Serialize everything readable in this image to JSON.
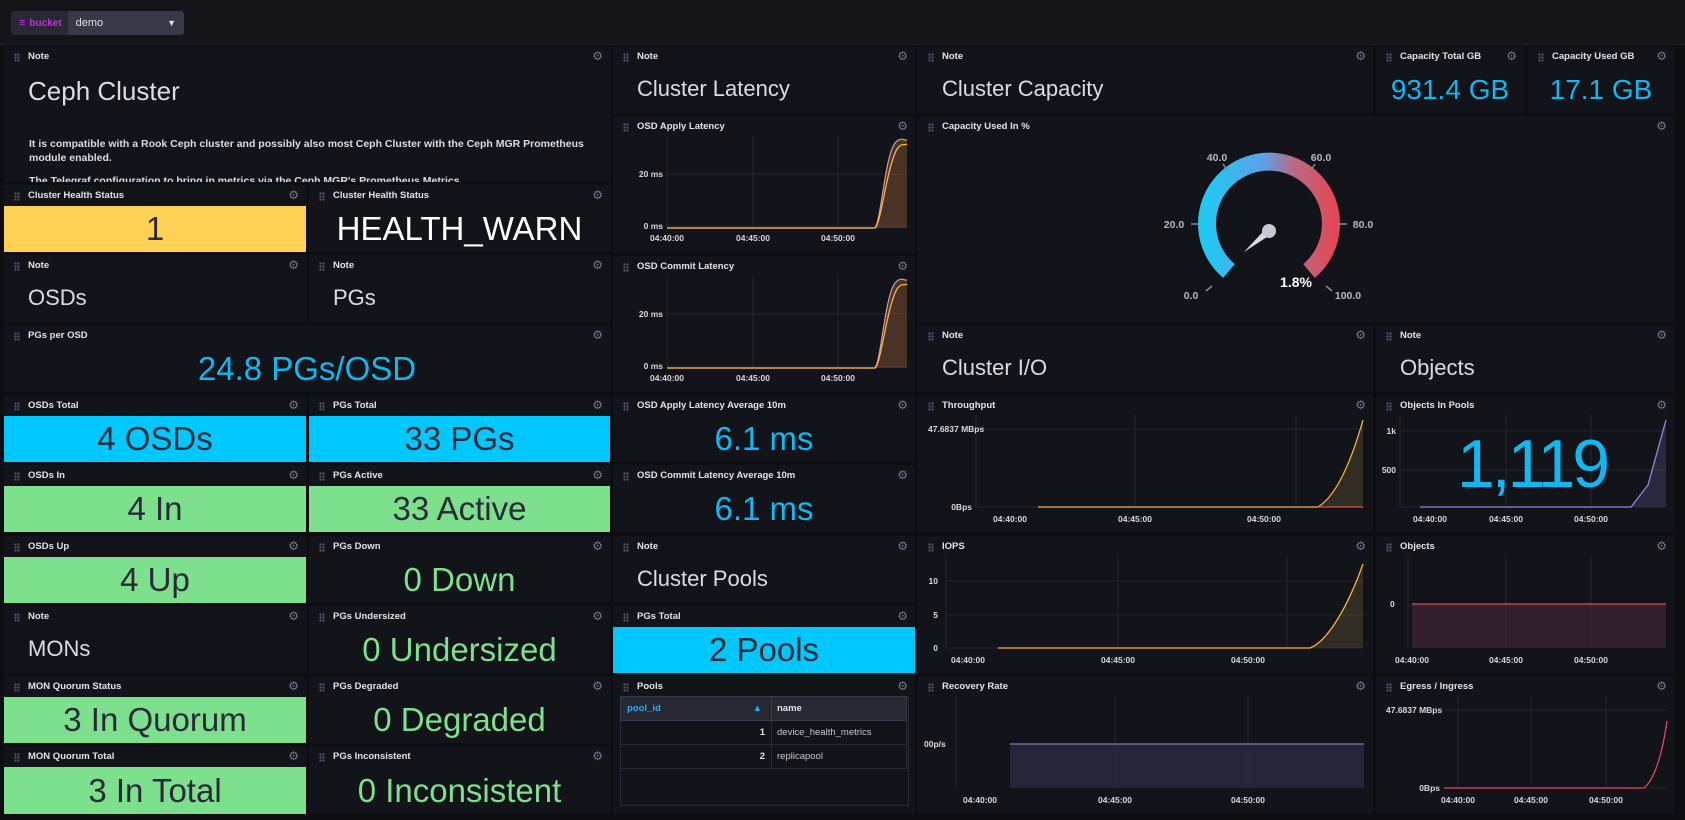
{
  "topbar": {
    "variable_label": "bucket",
    "variable_value": "demo"
  },
  "note_cluster": {
    "title": "Note",
    "heading": "Ceph Cluster",
    "para1": "It is compatible with a Rook Ceph cluster and possibly also most Ceph Cluster with the Ceph MGR Prometheus module enabled.",
    "para2": "The Telegraf configuration to bring in metrics via the Ceph MGR's Prometheus Metrics"
  },
  "cluster_health_status": {
    "title": "Cluster Health Status",
    "value": "1"
  },
  "cluster_health_status_text": {
    "title": "Cluster Health Status",
    "value": "HEALTH_WARN"
  },
  "note_osds": {
    "title": "Note",
    "heading": "OSDs"
  },
  "note_pgs": {
    "title": "Note",
    "heading": "PGs"
  },
  "pgs_per_osd": {
    "title": "PGs per OSD",
    "value": "24.8 PGs/OSD"
  },
  "osds_total": {
    "title": "OSDs Total",
    "value": "4 OSDs"
  },
  "pgs_total": {
    "title": "PGs Total",
    "value": "33 PGs"
  },
  "osds_in": {
    "title": "OSDs In",
    "value": "4 In"
  },
  "pgs_active": {
    "title": "PGs Active",
    "value": "33 Active"
  },
  "osds_up": {
    "title": "OSDs Up",
    "value": "4 Up"
  },
  "pgs_down": {
    "title": "PGs Down",
    "value": "0 Down"
  },
  "note_mons": {
    "title": "Note",
    "heading": "MONs"
  },
  "pgs_undersized": {
    "title": "PGs Undersized",
    "value": "0 Undersized"
  },
  "mon_quorum_status": {
    "title": "MON Quorum Status",
    "value": "3 In Quorum"
  },
  "pgs_degraded": {
    "title": "PGs Degraded",
    "value": "0 Degraded"
  },
  "mon_quorum_total": {
    "title": "MON Quorum Total",
    "value": "3 In Total"
  },
  "pgs_inconsistent": {
    "title": "PGs Inconsistent",
    "value": "0 Inconsistent"
  },
  "note_latency": {
    "title": "Note",
    "heading": "Cluster Latency"
  },
  "osd_apply_latency": {
    "title": "OSD Apply Latency",
    "y_ticks": [
      "20 ms",
      "0 ms"
    ],
    "x_ticks": [
      "04:40:00",
      "04:45:00",
      "04:50:00"
    ]
  },
  "osd_commit_latency": {
    "title": "OSD Commit Latency",
    "y_ticks": [
      "20 ms",
      "0 ms"
    ],
    "x_ticks": [
      "04:40:00",
      "04:45:00",
      "04:50:00"
    ]
  },
  "osd_apply_latency_avg": {
    "title": "OSD Apply Latency Average 10m",
    "value": "6.1 ms"
  },
  "osd_commit_latency_avg": {
    "title": "OSD Commit Latency Average 10m",
    "value": "6.1 ms"
  },
  "note_pools": {
    "title": "Note",
    "heading": "Cluster Pools"
  },
  "pools_total": {
    "title": "PGs Total",
    "value": "2 Pools"
  },
  "pools_table": {
    "title": "Pools",
    "columns": [
      "pool_id",
      "name"
    ],
    "rows": [
      [
        "1",
        "device_health_metrics"
      ],
      [
        "2",
        "replicapool"
      ]
    ]
  },
  "note_capacity": {
    "title": "Note",
    "heading": "Cluster Capacity"
  },
  "capacity_total": {
    "title": "Capacity Total GB",
    "value": "931.4 GB"
  },
  "capacity_used": {
    "title": "Capacity Used GB",
    "value": "17.1 GB"
  },
  "capacity_used_pct": {
    "title": "Capacity Used In %",
    "value": "1.8%",
    "value_num": 1.8,
    "ticks": [
      "0.0",
      "20.0",
      "40.0",
      "60.0",
      "80.0",
      "100.0"
    ]
  },
  "note_io": {
    "title": "Note",
    "heading": "Cluster I/O"
  },
  "note_objects": {
    "title": "Note",
    "heading": "Objects"
  },
  "throughput": {
    "title": "Throughput",
    "y_ticks": [
      "47.6837 MBps",
      "0Bps"
    ],
    "x_ticks": [
      "04:40:00",
      "04:45:00",
      "04:50:00"
    ]
  },
  "objects_in_pools": {
    "title": "Objects In Pools",
    "value": "1,119",
    "y_ticks": [
      "1k",
      "500"
    ],
    "x_ticks": [
      "04:40:00",
      "04:45:00",
      "04:50:00"
    ]
  },
  "iops": {
    "title": "IOPS",
    "y_ticks": [
      "10",
      "5",
      "0"
    ],
    "x_ticks": [
      "04:40:00",
      "04:45:00",
      "04:50:00"
    ]
  },
  "objects": {
    "title": "Objects",
    "y_ticks": [
      "0"
    ],
    "x_ticks": [
      "04:40:00",
      "04:45:00",
      "04:50:00"
    ]
  },
  "recovery_rate": {
    "title": "Recovery Rate",
    "y_ticks": [
      "00p/s"
    ],
    "x_ticks": [
      "04:40:00",
      "04:45:00",
      "04:50:00"
    ]
  },
  "egress_ingress": {
    "title": "Egress / Ingress",
    "y_ticks": [
      "47.6837 MBps",
      "0Bps"
    ],
    "x_ticks": [
      "04:40:00",
      "04:45:00",
      "04:50:00"
    ]
  },
  "colors": {
    "yellow": "#ffd255",
    "cyan": "#00c8ff",
    "green": "#7ce08c",
    "blue_text": "#0fb8f0"
  }
}
